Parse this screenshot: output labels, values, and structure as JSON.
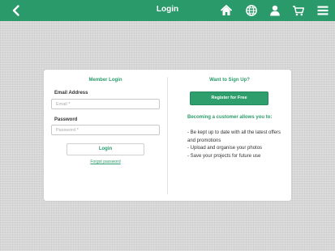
{
  "header": {
    "title": "Login",
    "icons": [
      "back-chevron-icon",
      "home-icon",
      "globe-icon",
      "user-icon",
      "cart-icon",
      "hamburger-menu-icon"
    ]
  },
  "login": {
    "heading": "Member Login",
    "email_label": "Email Address",
    "email_placeholder": "Email *",
    "email_value": "",
    "password_label": "Password",
    "password_placeholder": "Password *",
    "password_value": "",
    "login_button": "Login",
    "forgot_link": "Forgot password"
  },
  "signup": {
    "heading": "Want to Sign Up?",
    "register_button": "Register for Free",
    "benefits_heading": "Becoming a customer allows you to:",
    "benefits": [
      "- Be kept up to date with all the latest offers and promotions",
      "- Upload and organise your photos",
      "- Save your projects for future use"
    ]
  },
  "colors": {
    "accent": "#2a9a6a",
    "background": "#d7d7d7",
    "card": "#ffffff"
  }
}
